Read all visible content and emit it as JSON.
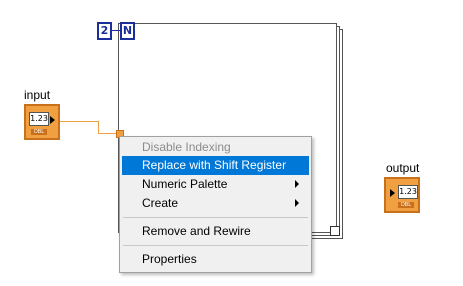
{
  "loop": {
    "count_value": "2",
    "count_terminal": "N"
  },
  "controls": {
    "input": {
      "label": "input",
      "value": "1.23",
      "type": "DBL"
    },
    "output": {
      "label": "output",
      "value": "1.23",
      "type": "DBL"
    }
  },
  "context_menu": {
    "items": [
      {
        "label": "Disable Indexing",
        "state": "disabled"
      },
      {
        "label": "Replace with Shift Register",
        "state": "highlighted"
      },
      {
        "label": "Numeric Palette",
        "submenu": true
      },
      {
        "label": "Create",
        "submenu": true
      },
      {
        "label": "Remove and Rewire"
      },
      {
        "label": "Properties"
      }
    ],
    "highlight_color": "#0078d7"
  },
  "colors": {
    "wire": "#f0a040",
    "constant_border": "#1b2f9a"
  }
}
